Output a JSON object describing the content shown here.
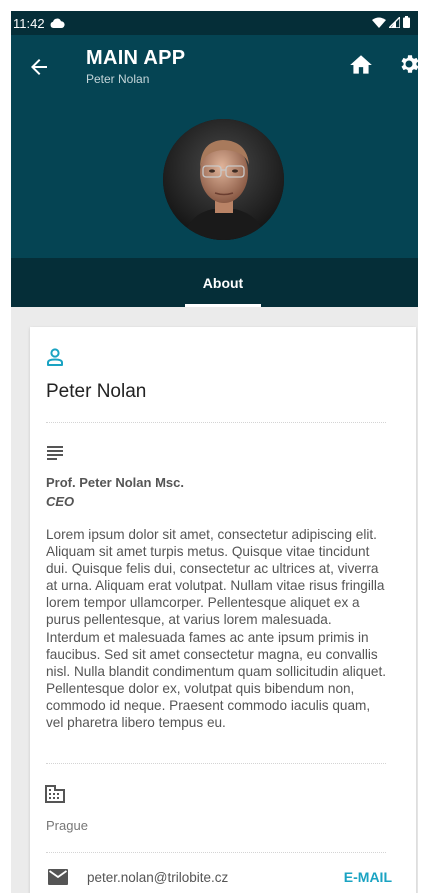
{
  "status_bar": {
    "time": "11:42"
  },
  "app_bar": {
    "title": "MAIN APP",
    "subtitle": "Peter Nolan"
  },
  "tabs": [
    {
      "label": "About",
      "active": true
    }
  ],
  "profile": {
    "name": "Peter Nolan",
    "title": "Prof. Peter Nolan Msc.",
    "role": "CEO",
    "bio": "Lorem ipsum dolor sit amet, consectetur adipiscing elit. Aliquam sit amet turpis metus. Quisque vitae tincidunt dui. Quisque felis dui, consectetur ac ultrices at, viverra at urna. Aliquam erat volutpat. Nullam vitae risus fringilla lorem tempor ullamcorper. Pellentesque aliquet ex a purus pellentesque, at varius lorem malesuada. Interdum et malesuada fames ac ante ipsum primis in faucibus. Sed sit amet consectetur magna, eu convallis nisl. Nulla blandit condimentum quam sollicitudin aliquet. Pellentesque dolor ex, volutpat quis bibendum non, commodo id neque. Praesent commodo iaculis quam, vel pharetra libero tempus eu.",
    "city": "Prague",
    "email": "peter.nolan@trilobite.cz",
    "email_action": "E-MAIL"
  },
  "colors": {
    "app_bar": "#054453",
    "status_bar": "#052e38",
    "accent": "#1aa3c2"
  },
  "icons": [
    "cloud-icon",
    "wifi-icon",
    "signal-icon",
    "battery-icon",
    "back-arrow-icon",
    "home-icon",
    "gear-icon",
    "person-icon",
    "notes-icon",
    "building-icon",
    "mail-icon"
  ]
}
